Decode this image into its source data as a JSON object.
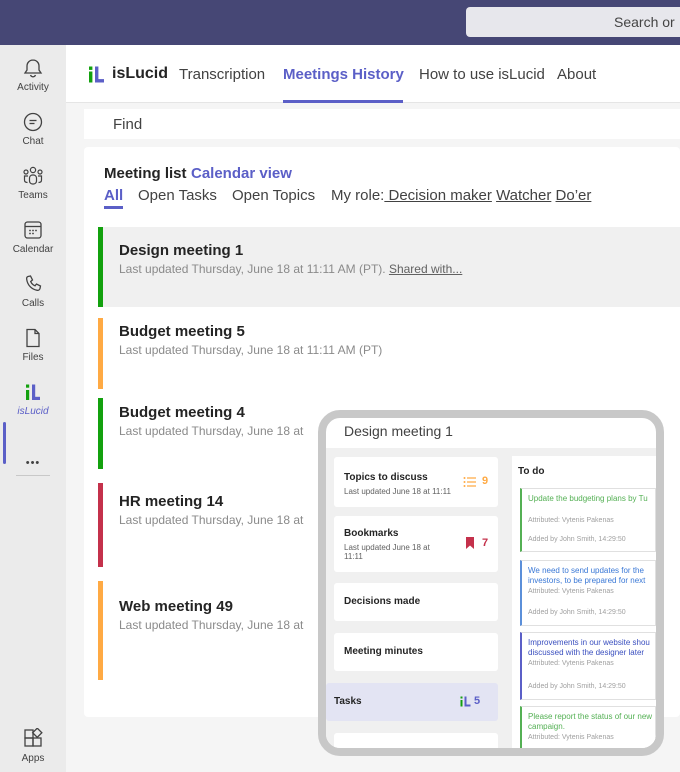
{
  "search": {
    "placeholder": "Search or"
  },
  "rail": [
    {
      "label": "Activity",
      "icon": "bell-icon"
    },
    {
      "label": "Chat",
      "icon": "chat-icon"
    },
    {
      "label": "Teams",
      "icon": "teams-icon"
    },
    {
      "label": "Calendar",
      "icon": "calendar-icon"
    },
    {
      "label": "Calls",
      "icon": "phone-icon"
    },
    {
      "label": "Files",
      "icon": "file-icon"
    },
    {
      "label": "isLucid",
      "icon": "islucid-icon"
    },
    {
      "label": "•••",
      "icon": "more-icon"
    },
    {
      "label": "Apps",
      "icon": "apps-icon"
    }
  ],
  "app": {
    "name": "isLucid",
    "tabs": [
      "Transcription",
      "Meetings History",
      "How to use isLucid",
      "About"
    ],
    "find_placeholder": "Find"
  },
  "list": {
    "title": "Meeting list",
    "calendar_link": "Calendar view",
    "filters": [
      "All",
      "Open Tasks",
      "Open Topics"
    ],
    "role_label": "My role:",
    "roles": [
      " Decision maker",
      "Watcher",
      "Do’er"
    ]
  },
  "meetings": [
    {
      "name": "Design meeting 1",
      "meta": "Last updated Thursday, June 18 at 11:11 AM (PT). ",
      "shared": "Shared with...",
      "color": "#13a10e"
    },
    {
      "name": "Budget meeting 5",
      "meta": "Last updated Thursday, June 18 at 11:11 AM (PT)",
      "shared": "",
      "color": "#ffaa44"
    },
    {
      "name": "Budget meeting 4",
      "meta": "Last updated Thursday, June 18 at",
      "shared": "",
      "color": "#13a10e"
    },
    {
      "name": "HR meeting 14",
      "meta": "Last updated Thursday, June 18 at",
      "shared": "",
      "color": "#c4314b"
    },
    {
      "name": "Web meeting 49",
      "meta": "Last updated Thursday, June 18 at",
      "shared": "",
      "color": "#ffaa44"
    }
  ],
  "preview": {
    "title": "Design meeting 1",
    "tiles": [
      {
        "title": "Topics to discuss",
        "sub": "Last updated June 18 at 11:11",
        "badge": "9",
        "badge_color": "#ffaa44",
        "icon": "list-icon"
      },
      {
        "title": "Bookmarks",
        "sub": "Last updated June 18 at 11:11",
        "badge": "7",
        "badge_color": "#c4314b",
        "icon": "bookmark-icon"
      },
      {
        "title": "Decisions made",
        "sub": "",
        "badge": "",
        "badge_color": "",
        "icon": ""
      },
      {
        "title": "Meeting minutes",
        "sub": "",
        "badge": "",
        "badge_color": "",
        "icon": ""
      },
      {
        "title": "Tasks",
        "sub": "",
        "badge": "5",
        "badge_color": "#5b5fc7",
        "icon": "islucid-icon"
      }
    ],
    "todo_title": "To do",
    "todos": [
      {
        "text": "Update the budgeting plans by Tu",
        "attributed": "Attributed: Vytenis Pakenas",
        "added": "Added by John Smith, 14:29:50",
        "color": "#54b054"
      },
      {
        "text": "We need to send updates for the investors, to be prepared for next",
        "attributed": "Attributed: Vytenis Pakenas",
        "added": "Added by John Smith, 14:29:50",
        "color": "#5b8fd9"
      },
      {
        "text": "Improvements in our website shou discussed with the designer later",
        "attributed": "Attributed: Vytenis Pakenas",
        "added": "Added by John Smith, 14:29:50",
        "color": "#5b5fc7"
      },
      {
        "text": "Please report the status of our new campaign.",
        "attributed": "Attributed: Vytenis Pakenas",
        "added": "",
        "color": "#54b054"
      }
    ]
  }
}
